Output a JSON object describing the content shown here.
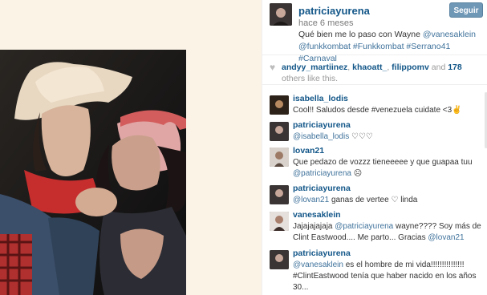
{
  "header": {
    "username": "patriciayurena",
    "time_ago": "hace 6 meses",
    "follow_label": "Seguir",
    "caption_text": "Qué bien me lo paso con Wayne",
    "caption_mention1": "@vanesaklein",
    "caption_mention2": "@funkkombat",
    "caption_hashtags": "#Funkkombat #Serrano41 #Carnaval"
  },
  "likes": {
    "user1": "andyy_martiinez",
    "user2": "khaoatt_",
    "user3": "filippomv",
    "and_text": "and",
    "count": "178",
    "others_text": "others like this."
  },
  "comments": [
    {
      "user": "isabella_lodis",
      "text": "Cool!! Saludos desde #venezuela cuidate <3✌"
    },
    {
      "user": "patriciayurena",
      "mention": "@isabella_lodis",
      "text": " ♡♡♡"
    },
    {
      "user": "lovan21",
      "text": "Que pedazo de vozzz tieneeeee y que guapaa tuu",
      "mention": "@patriciayurena",
      "text2": " ☹"
    },
    {
      "user": "patriciayurena",
      "mention": "@lovan21",
      "text": " ganas de vertee ♡ linda"
    },
    {
      "user": "vanesaklein",
      "text": "Jajajajajaja ",
      "mention": "@patriciayurena",
      "text2": " wayne???? Soy más de Clint Eastwood.... Me parto... Gracias ",
      "mention2": "@lovan21"
    },
    {
      "user": "patriciayurena",
      "mention": "@vanesaklein",
      "text": " es el hombre de mi vida!!!!!!!!!!!!!!! #ClintEastwood tenía que haber nacido en los años 30..."
    }
  ],
  "icons": {
    "heart": "heart-icon"
  },
  "colors": {
    "username": "#125688",
    "link": "#3f729b",
    "follow_button": "#6f97b6"
  }
}
